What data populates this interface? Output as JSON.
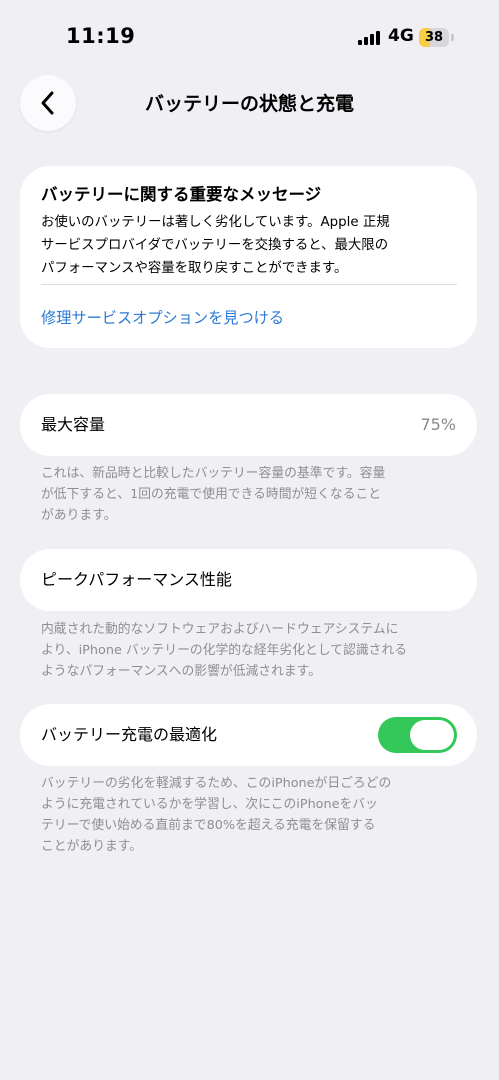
{
  "status_bar": {
    "time": "11:19",
    "network": "4G",
    "battery_level": "38",
    "battery_fraction": 0.38,
    "signal_icon": "cellular-signal-icon",
    "battery_icon": "battery-icon"
  },
  "nav": {
    "title": "バッテリーの状態と充電",
    "back_icon": "chevron-left-icon"
  },
  "message": {
    "title": "バッテリーに関する重要なメッセージ",
    "body_lines": [
      "お使いのバッテリーは著しく劣化しています。Apple 正規",
      "サービスプロバイダでバッテリーを交換すると、最大限の",
      "パフォーマンスや容量を取り戻すことができます。"
    ],
    "link": "修理サービスオプションを見つける"
  },
  "max_capacity": {
    "label": "最大容量",
    "value": "75%",
    "footnote_lines": [
      "これは、新品時と比較したバッテリー容量の基準です。容量",
      "が低下すると、1回の充電で使用できる時間が短くなること",
      "があります。"
    ]
  },
  "peak_performance": {
    "label": "ピークパフォーマンス性能",
    "footnote_lines": [
      "内蔵された動的なソフトウェアおよびハードウェアシステムに",
      "より、iPhone バッテリーの化学的な経年劣化として認識される",
      "ようなパフォーマンスへの影響が低減されます。"
    ]
  },
  "optimized_charging": {
    "label": "バッテリー充電の最適化",
    "enabled": true,
    "footnote_lines": [
      "バッテリーの劣化を軽減するため、このiPhoneが日ごろどの",
      "ように充電されているかを学習し、次にこのiPhoneをバッ",
      "テリーで使い始める直前まで80%を超える充電を保留する",
      "ことがあります。"
    ]
  },
  "colors": {
    "background": "#efeff4",
    "link": "#2d7ad6",
    "toggle_on": "#34c759",
    "battery_fill": "#f7ce46",
    "secondary_text": "#8e8e93"
  }
}
